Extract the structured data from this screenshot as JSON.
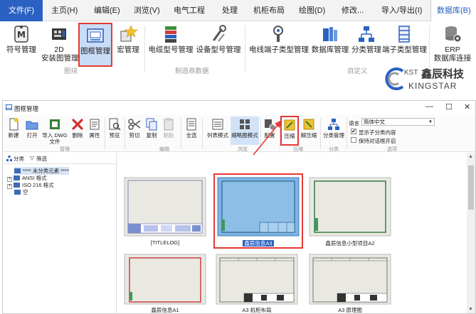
{
  "colors": {
    "accent": "#2b61c2",
    "highlight_red": "#e53935",
    "selected_bg": "#c9dcf6",
    "group_label": "#9a9a9a"
  },
  "menu": {
    "file": "文件(F)",
    "tabs": [
      "主页(H)",
      "编辑(E)",
      "浏览(V)",
      "电气工程",
      "处理",
      "机柜布局",
      "绘图(D)",
      "修改...",
      "导入/导出(I)"
    ],
    "active_tab": "数据库(B)"
  },
  "ribbon": {
    "buttons": {
      "symbol_mgmt": "符号管理",
      "mount_2d_line1": "2D",
      "mount_2d_line2": "安装图管理",
      "frame_mgmt": "图框管理",
      "macro_mgmt": "宏管理",
      "cable_type": "电缆型号管理",
      "device_type": "设备型号管理",
      "wire_terminal_type": "电线端子类型管理",
      "database_mgmt": "数据库管理",
      "category_mgmt": "分类管理",
      "terminal_type": "端子类型管理",
      "erp_line1": "ERP",
      "erp_line2": "数据库连接"
    },
    "groups": {
      "library": "图块",
      "manufacturer_data": "制造商数据",
      "custom": "自定义"
    },
    "icons": [
      "symbol-icon",
      "mount-2d-icon",
      "frame-icon",
      "macro-star-icon",
      "cable-icon",
      "device-wrench-icon",
      "wire-terminal-icon",
      "database-icon",
      "category-tree-icon",
      "terminal-icon",
      "erp-database-gear-icon"
    ]
  },
  "logo": {
    "brand": "KST",
    "name_cn": "鑫辰科技",
    "name_en": "KINGSTAR"
  },
  "window": {
    "title": "图框管理",
    "controls": {
      "minimize": "—",
      "maximize": "☐",
      "close": "✕"
    }
  },
  "toolbar": {
    "new": "新建",
    "open": "打开",
    "import_dwg_line1": "导入 DWG",
    "import_dwg_line2": "文件",
    "delete": "删除",
    "properties": "属性",
    "preview": "预览",
    "cut": "剪切",
    "copy": "复制",
    "paste": "粘贴",
    "select_all": "全选",
    "list_mode": "列表模式",
    "thumb_mode": "缩略图模式",
    "config": "配置",
    "compress": "压缩",
    "decompress": "解压缩",
    "category_mgmt": "分类管理",
    "groups": {
      "manage": "管理",
      "edit": "编辑",
      "browse": "浏览",
      "compress": "压缩",
      "category": "分类",
      "options": "选项"
    },
    "options": {
      "language_label": "语言",
      "language_value": "简体中文",
      "show_subcategory": "显示子分类内容",
      "show_subcategory_checked": true,
      "keep_dialog_open": "保持对话框开启",
      "keep_dialog_open_checked": false
    }
  },
  "tree": {
    "tabs": [
      "分类",
      "筛选"
    ],
    "nodes": [
      {
        "label": "**** 未分类元素 ****",
        "expandable": false,
        "selected": true
      },
      {
        "label": "ANSI 格式",
        "expandable": true
      },
      {
        "label": "ISO 216 格式",
        "expandable": true
      },
      {
        "label": "空",
        "expandable": false
      }
    ]
  },
  "thumbnails": [
    {
      "caption": "[TITLELOG]",
      "selected": false,
      "style": "titlelog"
    },
    {
      "caption": "鑫辰信息A3",
      "selected": true,
      "style": "blue"
    },
    {
      "caption": "鑫辰信息小型项目A2",
      "selected": false,
      "style": "green"
    },
    {
      "caption": "鑫辰信息A1",
      "selected": false,
      "style": "red"
    },
    {
      "caption": "A3 机柜布局",
      "selected": false,
      "style": "grid"
    },
    {
      "caption": "A3 原理图",
      "selected": false,
      "style": "grid"
    }
  ]
}
